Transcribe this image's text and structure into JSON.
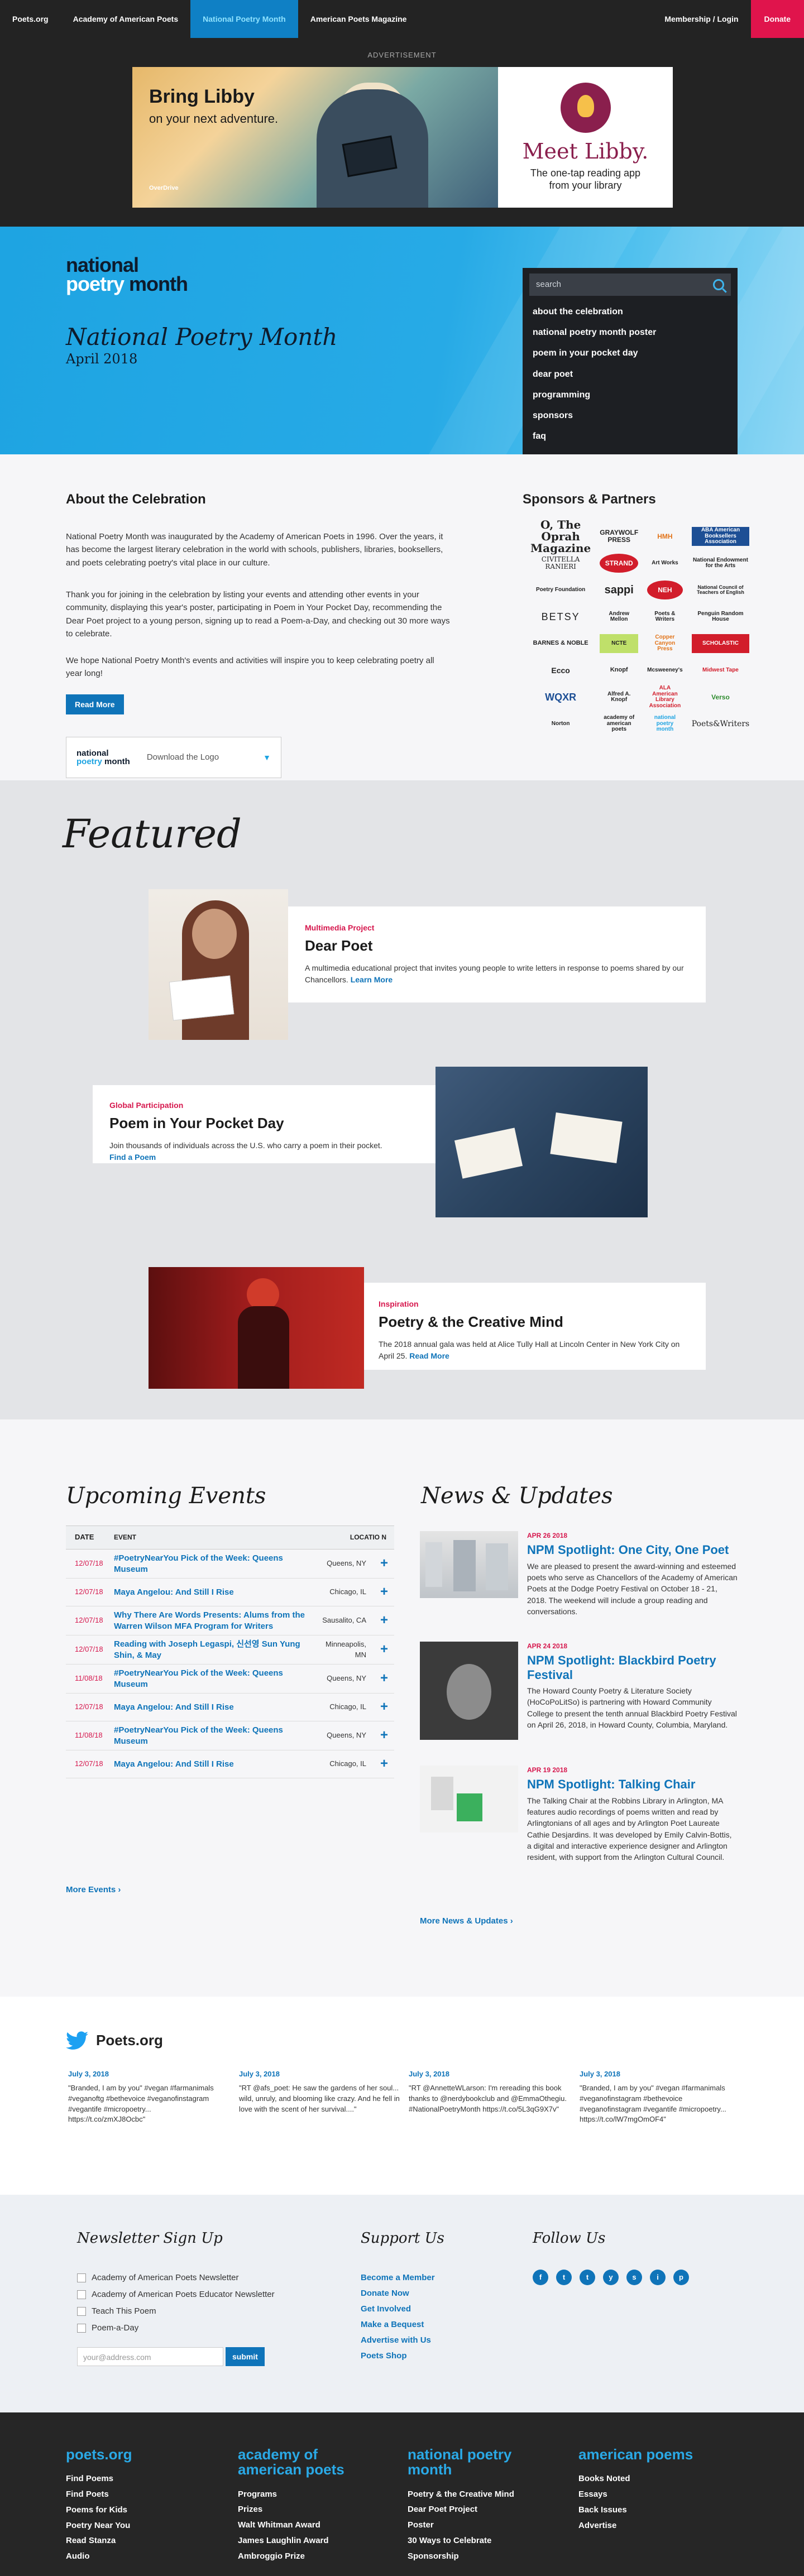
{
  "topnav": {
    "items": [
      "Poets.org",
      "Academy of American Poets",
      "National Poetry Month",
      "American Poets Magazine"
    ],
    "membership": "Membership / Login",
    "donate": "Donate"
  },
  "ad": {
    "label": "ADVERTISEMENT",
    "headline": "Bring Libby",
    "subhead": "on your next adventure.",
    "brand": "OverDrive",
    "meet": "Meet Libby.",
    "tagline1": "The one-tap reading app",
    "tagline2": "from your library"
  },
  "hero": {
    "logo_line1": "national",
    "logo_line2a": "poetry",
    "logo_line2b": "month",
    "title": "National Poetry Month",
    "date": "April 2018",
    "search_placeholder": "search",
    "menu": [
      "about the celebration",
      "national poetry month poster",
      "poem in your pocket day",
      "dear poet",
      "programming",
      "sponsors",
      "faq"
    ]
  },
  "about": {
    "heading": "About the Celebration",
    "p1": "National Poetry Month was inaugurated by the Academy of American Poets in 1996. Over the years, it has become the largest literary celebration in the world with schools, publishers, libraries, booksellers, and poets celebrating poetry's vital place in our culture.",
    "p2": "Thank you for joining in the celebration by listing your events and attending other events in your community, displaying this year's poster, participating in Poem in Your Pocket Day, recommending the Dear Poet project to a young person, signing up to read a Poem-a-Day, and checking out 30 more ways to celebrate.",
    "p3": "We hope National Poetry Month's events and activities will inspire you to keep celebrating poetry all year long!",
    "read_more": "Read More",
    "download_logo_a": "national",
    "download_logo_b": "poetry",
    "download_logo_c": "month",
    "download_label": "Download the Logo",
    "sponsors_heading": "Sponsors & Partners",
    "sponsors": [
      "O, The Oprah Magazine",
      "GRAYWOLF PRESS",
      "HMH",
      "ABA American Booksellers Association",
      "CIVITELLA RANIERI",
      "STRAND",
      "Art Works",
      "National Endowment for the Arts",
      "Poetry Foundation",
      "sappi",
      "NEH",
      "National Council of Teachers of English",
      "BETSY",
      "Andrew Mellon",
      "Poets & Writers",
      "Penguin Random House",
      "BARNES & NOBLE",
      "NCTE",
      "Copper Canyon Press",
      "SCHOLASTIC",
      "Ecco",
      "Knopf",
      "Mcsweeney's",
      "Midwest Tape",
      "WQXR",
      "Alfred A. Knopf",
      "ALA American Library Association",
      "Verso",
      "Norton",
      "academy of american poets",
      "national poetry month",
      "Poets&Writers"
    ]
  },
  "featured": {
    "heading": "Featured",
    "cards": [
      {
        "category": "Multimedia Project",
        "title": "Dear Poet",
        "desc": "A multimedia educational project that invites young people to write letters in response to poems shared by our Chancellors.",
        "link": "Learn More"
      },
      {
        "category": "Global Participation",
        "title": "Poem in Your Pocket Day",
        "desc": "Join thousands of individuals across the U.S. who carry a poem in their pocket.",
        "link": "Find a Poem"
      },
      {
        "category": "Inspiration",
        "title": "Poetry & the Creative Mind",
        "desc": "The 2018 annual gala was held at Alice Tully Hall at Lincoln Center in New York City on April 25.",
        "link": "Read More"
      }
    ]
  },
  "events": {
    "heading": "Upcoming Events",
    "cols": [
      "DATE",
      "EVENT",
      "LOCATIO N"
    ],
    "rows": [
      {
        "date": "12/07/18",
        "event": "#PoetryNearYou Pick of the Week: Queens Museum",
        "loc": "Queens, NY"
      },
      {
        "date": "12/07/18",
        "event": "Maya Angelou: And Still I Rise",
        "loc": "Chicago, IL"
      },
      {
        "date": "12/07/18",
        "event": "Why There Are Words Presents: Alums from the Warren Wilson MFA Program for Writers",
        "loc": "Sausalito, CA"
      },
      {
        "date": "12/07/18",
        "event": "Reading with Joseph Legaspi, 신선영 Sun Yung Shin, & May",
        "loc": "Minneapolis, MN"
      },
      {
        "date": "11/08/18",
        "event": "#PoetryNearYou Pick of the Week: Queens Museum",
        "loc": "Queens, NY"
      },
      {
        "date": "12/07/18",
        "event": "Maya Angelou: And Still I Rise",
        "loc": "Chicago, IL"
      },
      {
        "date": "11/08/18",
        "event": "#PoetryNearYou Pick of the Week: Queens Museum",
        "loc": "Queens, NY"
      },
      {
        "date": "12/07/18",
        "event": "Maya Angelou: And Still I Rise",
        "loc": "Chicago, IL"
      }
    ],
    "more": "More Events"
  },
  "news": {
    "heading": "News & Updates",
    "items": [
      {
        "date": "APR 26 2018",
        "title": "NPM Spotlight: One City, One Poet",
        "body": "We are pleased to present the award-winning and esteemed poets who serve as Chancellors of the Academy of American Poets at the Dodge Poetry Festival on October 18 - 21, 2018. The weekend will include a group reading and conversations."
      },
      {
        "date": "APR 24 2018",
        "title": "NPM Spotlight: Blackbird Poetry Festival",
        "body": "The Howard County Poetry & Literature Society (HoCoPoLitSo) is partnering with Howard Community College to present the tenth annual Blackbird Poetry Festival on April 26, 2018, in Howard County, Columbia, Maryland."
      },
      {
        "date": "APR 19 2018",
        "title": "NPM Spotlight: Talking Chair",
        "body": "The Talking Chair at the Robbins Library in Arlington, MA features audio recordings of poems written and read by Arlingtonians of all ages and by Arlington Poet Laureate Cathie Desjardins. It was developed by Emily Calvin-Bottis, a digital and interactive experience designer and Arlington resident, with support from the Arlington Cultural Council."
      }
    ],
    "more": "More News & Updates"
  },
  "twitter": {
    "heading": "Poets.org",
    "tweets": [
      {
        "date": "July 3, 2018",
        "text": "\"Branded, I am by you\" #vegan #farmanimals #veganoftg #bethevoice #veganofinstagram #vegantife #micropoetry... https://t.co/zmXJ8Ocbc\""
      },
      {
        "date": "July 3, 2018",
        "text": "\"RT @afs_poet: He saw the gardens of her soul... wild, unruly, and blooming like crazy. And he fell in love with the scent of her survival....\""
      },
      {
        "date": "July 3, 2018",
        "text": "\"RT @AnnetteWLarson: I'm rereading this book thanks to @nerdybookclub and @EmmaOthegiu. #NationalPoetryMonth https://t.co/5L3qG9X7v\""
      },
      {
        "date": "July 3, 2018",
        "text": "\"Branded, I am by you\" #vegan #farmanimals #veganofinstagram #bethevoice #veganofinstagram #vegantife #micropoetry... https://t.co/lW7mgOmOF4\""
      }
    ]
  },
  "newsletter": {
    "heading": "Newsletter Sign Up",
    "options": [
      "Academy of American Poets Newsletter",
      "Academy of American Poets Educator Newsletter",
      "Teach This Poem",
      "Poem-a-Day"
    ],
    "email_placeholder": "your@address.com",
    "submit": "submit",
    "support_heading": "Support Us",
    "support_links": [
      "Become a Member",
      "Donate Now",
      "Get Involved",
      "Make a Bequest",
      "Advertise with Us",
      "Poets Shop"
    ],
    "follow_heading": "Follow Us",
    "social": [
      "f",
      "t",
      "t",
      "y",
      "s",
      "i",
      "p"
    ]
  },
  "footer": {
    "cols": [
      {
        "title": "poets.org",
        "links": [
          "Find Poems",
          "Find Poets",
          "Poems for Kids",
          "Poetry Near You",
          "Read Stanza",
          "Audio"
        ]
      },
      {
        "title": "academy of american poets",
        "links": [
          "Programs",
          "Prizes",
          "Walt Whitman Award",
          "James Laughlin Award",
          "Ambroggio Prize"
        ]
      },
      {
        "title": "national poetry month",
        "links": [
          "Poetry & the Creative Mind",
          "Dear Poet Project",
          "Poster",
          "30 Ways to Celebrate",
          "Sponsorship"
        ]
      },
      {
        "title": "american poems",
        "links": [
          "Books Noted",
          "Essays",
          "Back Issues",
          "Advertise"
        ]
      }
    ]
  },
  "colors": {
    "accent": "#0f74b9",
    "hero_blue": "#27aae6",
    "donate": "#e0144c",
    "category": "#d6174d"
  }
}
